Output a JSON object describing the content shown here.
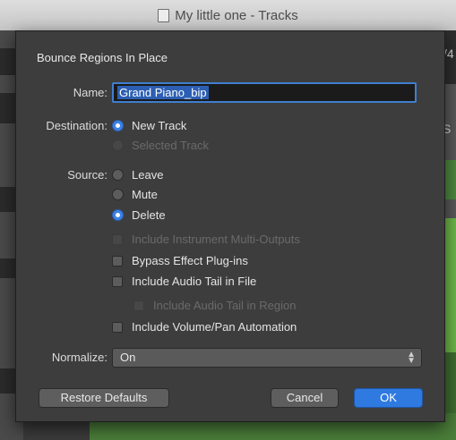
{
  "window": {
    "title": "My little one - Tracks"
  },
  "background": {
    "right_text_1": "/4",
    "right_text_2": "S"
  },
  "dialog": {
    "title": "Bounce Regions In Place",
    "name": {
      "label": "Name:",
      "value": "Grand Piano_bip"
    },
    "destination": {
      "label": "Destination:",
      "options": [
        {
          "label": "New Track",
          "selected": true,
          "enabled": true
        },
        {
          "label": "Selected Track",
          "selected": false,
          "enabled": false
        }
      ]
    },
    "source": {
      "label": "Source:",
      "options": [
        {
          "label": "Leave",
          "selected": false,
          "enabled": true
        },
        {
          "label": "Mute",
          "selected": false,
          "enabled": true
        },
        {
          "label": "Delete",
          "selected": true,
          "enabled": true
        }
      ]
    },
    "checkboxes": [
      {
        "label": "Include Instrument Multi-Outputs",
        "checked": false,
        "enabled": false
      },
      {
        "label": "Bypass Effect Plug-ins",
        "checked": false,
        "enabled": true
      },
      {
        "label": "Include Audio Tail in File",
        "checked": false,
        "enabled": true
      },
      {
        "label": "Include Audio Tail in Region",
        "checked": false,
        "enabled": false
      },
      {
        "label": "Include Volume/Pan Automation",
        "checked": false,
        "enabled": true
      }
    ],
    "normalize": {
      "label": "Normalize:",
      "value": "On"
    },
    "buttons": {
      "restore": "Restore Defaults",
      "cancel": "Cancel",
      "ok": "OK"
    }
  },
  "colors": {
    "accent": "#3c82e6",
    "dialog_bg": "#3d3d3d",
    "track_green": "#4b7e3a"
  }
}
